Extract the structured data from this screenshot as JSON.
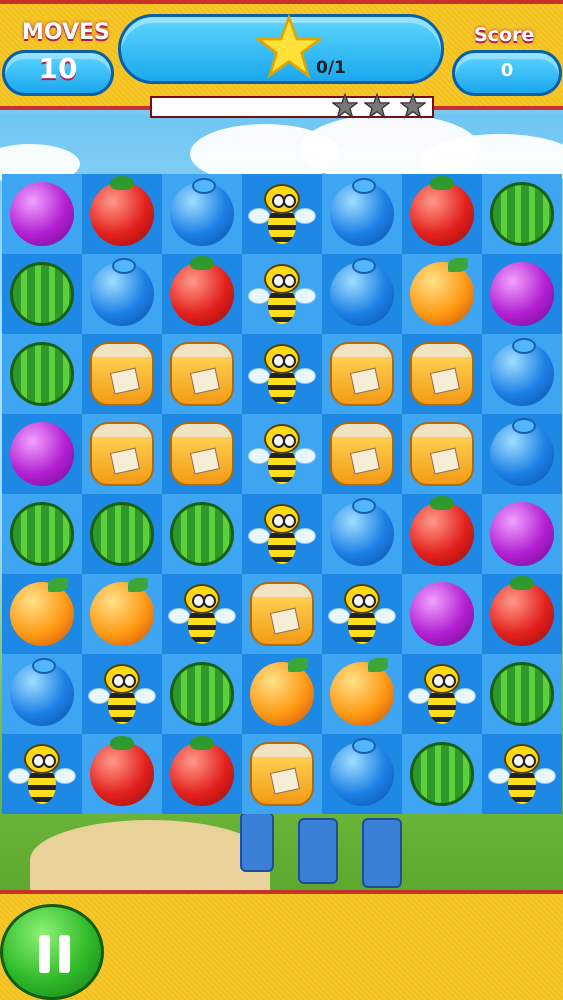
{
  "hud": {
    "moves_label": "MOVES",
    "moves_value": "10",
    "goal_count": "0/1",
    "score_label": "Score",
    "score_value": "0",
    "progress_fraction": 0.0,
    "progress_stars": 3,
    "icons": [
      "star-icon",
      "progress-star-icon"
    ]
  },
  "colors": {
    "hud_yellow": "#f4c524",
    "hud_border": "#c8322a",
    "pill_blue": "#19a8ee",
    "label_pink": "#b01c4c",
    "board_dark": "#1e88e5",
    "board_light": "#3ea5f2",
    "pause_green": "#2fba2a"
  },
  "board": {
    "columns": 7,
    "rows": 8,
    "grid": [
      [
        "plum",
        "tomato",
        "blueberry",
        "bee",
        "blueberry",
        "tomato",
        "melon"
      ],
      [
        "melon",
        "blueberry",
        "tomato",
        "bee",
        "blueberry",
        "orange",
        "plum"
      ],
      [
        "melon",
        "honey",
        "honey",
        "bee",
        "honey",
        "honey",
        "blueberry"
      ],
      [
        "plum",
        "honey",
        "honey",
        "bee",
        "honey",
        "honey",
        "blueberry"
      ],
      [
        "melon",
        "melon",
        "melon",
        "bee",
        "blueberry",
        "tomato",
        "plum"
      ],
      [
        "orange",
        "orange",
        "bee",
        "honey",
        "bee",
        "plum",
        "tomato"
      ],
      [
        "blueberry",
        "bee",
        "melon",
        "orange",
        "orange",
        "bee",
        "melon"
      ],
      [
        "bee",
        "tomato",
        "tomato",
        "honey",
        "blueberry",
        "melon",
        "bee"
      ]
    ]
  },
  "controls": {
    "pause_icon": "pause-icon"
  }
}
